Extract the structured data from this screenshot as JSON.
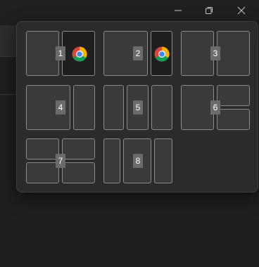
{
  "window": {
    "caption_buttons": [
      "minimize",
      "restore",
      "close"
    ]
  },
  "snap_layouts": [
    {
      "number": "1",
      "app_icon": "chrome-icon"
    },
    {
      "number": "2",
      "app_icon": "chrome-icon"
    },
    {
      "number": "3"
    },
    {
      "number": "4"
    },
    {
      "number": "5"
    },
    {
      "number": "6"
    },
    {
      "number": "7"
    },
    {
      "number": "8"
    }
  ],
  "colors": {
    "zone_fill": "#3a3a3a",
    "zone_border": "#8a8a8a",
    "flyout_bg": "#2b2b2b",
    "number_badge": "#6b6b6b"
  }
}
